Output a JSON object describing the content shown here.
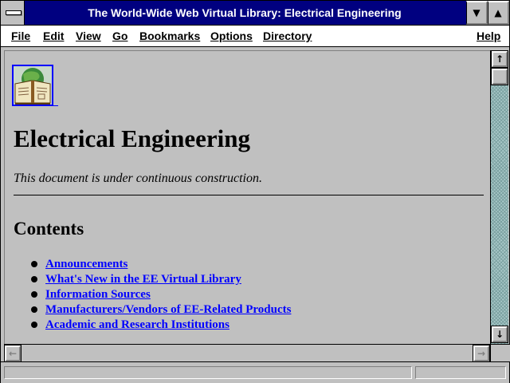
{
  "window": {
    "title": "The World-Wide Web Virtual Library: Electrical Engineering",
    "min_glyph": "▼",
    "max_glyph": "▲"
  },
  "menu": {
    "items": [
      {
        "label": "File",
        "underline": "F"
      },
      {
        "label": "Edit",
        "underline": "E"
      },
      {
        "label": "View",
        "underline": "V"
      },
      {
        "label": "Go",
        "underline": "G"
      },
      {
        "label": "Bookmarks",
        "underline": "B"
      },
      {
        "label": "Options",
        "underline": "O"
      },
      {
        "label": "Directory",
        "underline": "D"
      },
      {
        "label": "Help",
        "underline": "H"
      }
    ]
  },
  "page": {
    "title": "Electrical Engineering",
    "note": "This document is under continuous construction.",
    "contents_heading": "Contents",
    "links": [
      "Announcements",
      "What's New in the EE Virtual Library",
      "Information Sources",
      "Manufacturers/Vendors of EE-Related Products",
      "Academic and Research Institutions"
    ]
  },
  "scrollbar": {
    "up_glyph": "↑",
    "down_glyph": "↓",
    "left_glyph": "←",
    "right_glyph": "→"
  },
  "colors": {
    "titlebar": "#000080",
    "link": "#0000ff",
    "background": "#c0c0c0"
  },
  "icons": {
    "logo": "book-globe-icon"
  }
}
